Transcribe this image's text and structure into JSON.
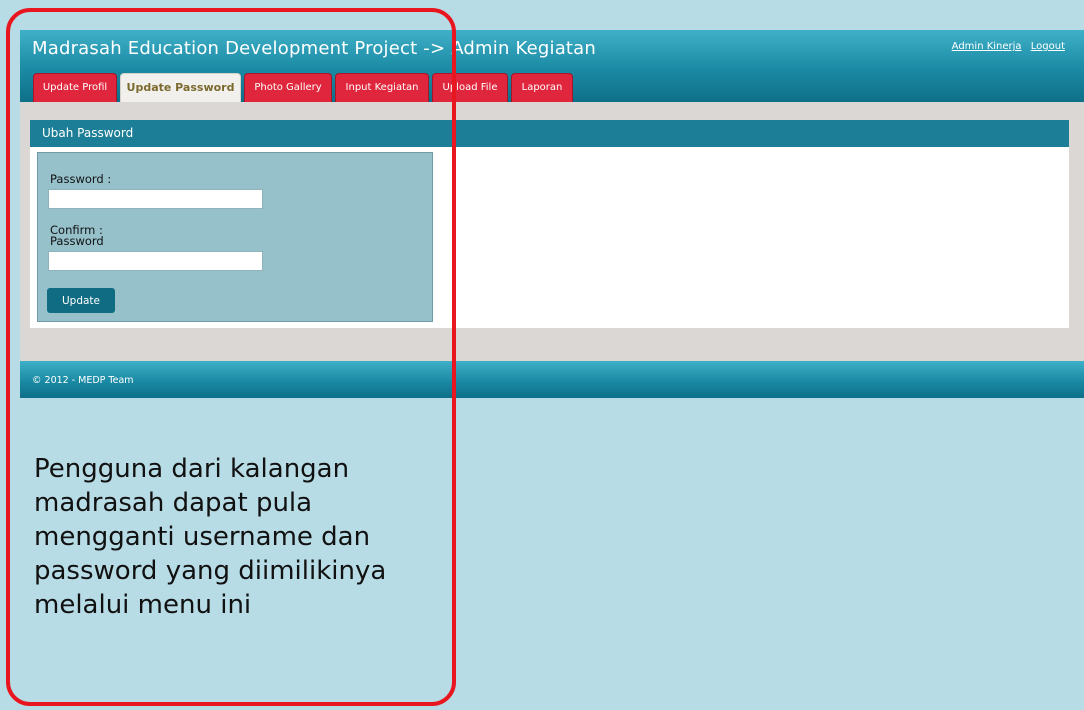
{
  "app": {
    "title": "Madrasah Education Development Project -> Admin Kegiatan",
    "user_links": {
      "account": "Admin Kinerja",
      "logout": "Logout"
    },
    "tabs": [
      {
        "label": "Update Profil",
        "active": false
      },
      {
        "label": "Update Password",
        "active": true
      },
      {
        "label": "Photo Gallery",
        "active": false
      },
      {
        "label": "Input Kegiatan",
        "active": false
      },
      {
        "label": "Upload File",
        "active": false
      },
      {
        "label": "Laporan",
        "active": false
      }
    ]
  },
  "panel": {
    "title": "Ubah Password",
    "form": {
      "password_label": "Password :",
      "password_value": "",
      "confirm_label_line1": "Confirm :",
      "confirm_label_line2": "Password",
      "confirm_value": "",
      "submit_label": "Update"
    }
  },
  "footer": {
    "text": "© 2012 - MEDP Team"
  },
  "caption": "Pengguna dari kalangan madrasah dapat pula mengganti username dan password yang diimilikinya melalui menu ini",
  "colors": {
    "page_background": "#b7dce6",
    "header_teal": "#1b8aa4",
    "tab_red": "#e0263c",
    "highlight_red": "#e8161e",
    "form_box": "#96c1cb",
    "button": "#0f6c82"
  }
}
